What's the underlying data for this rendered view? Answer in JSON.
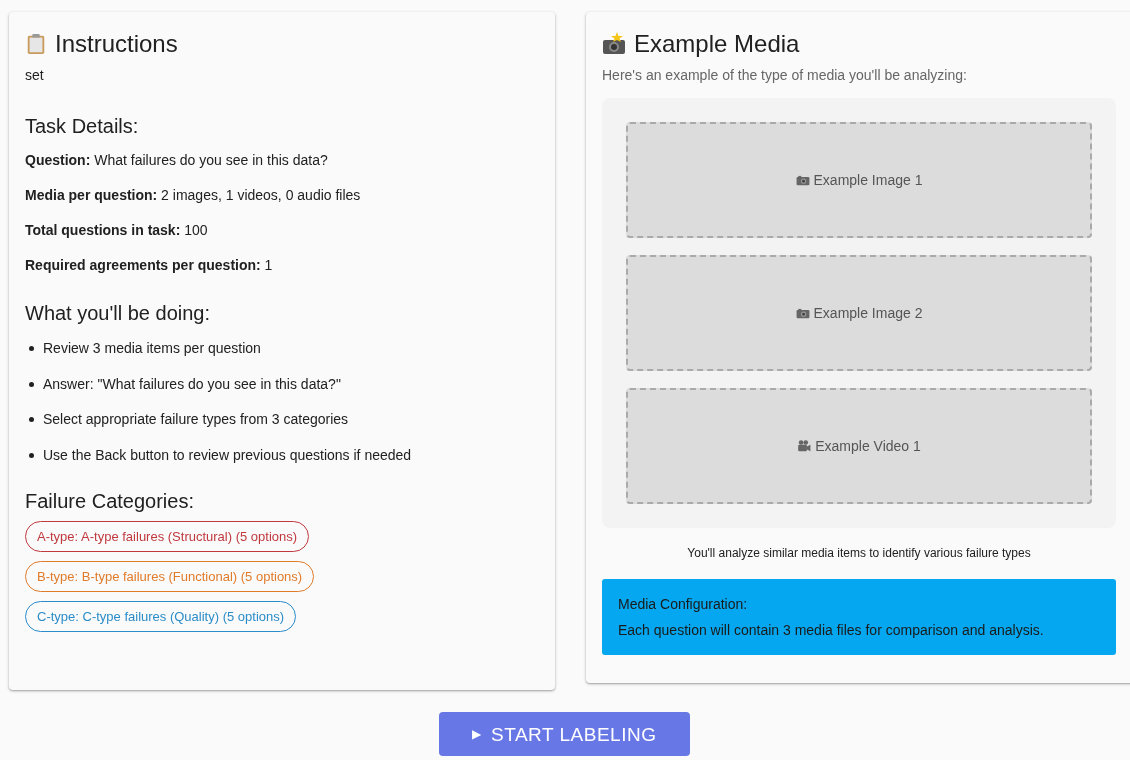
{
  "instructions": {
    "title": "Instructions",
    "description": "set",
    "task_details_heading": "Task Details:",
    "details": [
      "**Question:** What failures do you see in this data?",
      "**Media per question:** 2 images, 1 videos, 0 audio files",
      "**Total questions in task:** 100",
      "**Required agreements per question:** 1"
    ],
    "doing_heading": "What you'll be doing:",
    "doing_items": [
      "Review 3 media items per question",
      "Answer: \"What failures do you see in this data?\"",
      "Select appropriate failure types from 3 categories",
      "Use the Back button to review previous questions if needed"
    ],
    "categories_heading": "Failure Categories:",
    "categories": [
      {
        "text": "A-type: A-type failures (Structural) (5 options)",
        "color": "#c0393f"
      },
      {
        "text": "B-type: B-type failures (Functional) (5 options)",
        "color": "#e07b2a"
      },
      {
        "text": "C-type: C-type failures (Quality) (5 options)",
        "color": "#2a8cc8"
      }
    ]
  },
  "media": {
    "title": "Example Media",
    "subtitle": "Here's an example of the type of media you'll be analyzing:",
    "items": [
      {
        "kind": "image",
        "label": "Example Image 1"
      },
      {
        "kind": "image",
        "label": "Example Image 2"
      },
      {
        "kind": "video",
        "label": "Example Video 1"
      }
    ],
    "caption": "You'll analyze similar media items to identify various failure types",
    "config": {
      "title": "Media Configuration:",
      "text": "Each question will contain 3 media files for comparison and analysis."
    }
  },
  "start_button": {
    "icon": "▶",
    "label": "START LABELING"
  }
}
